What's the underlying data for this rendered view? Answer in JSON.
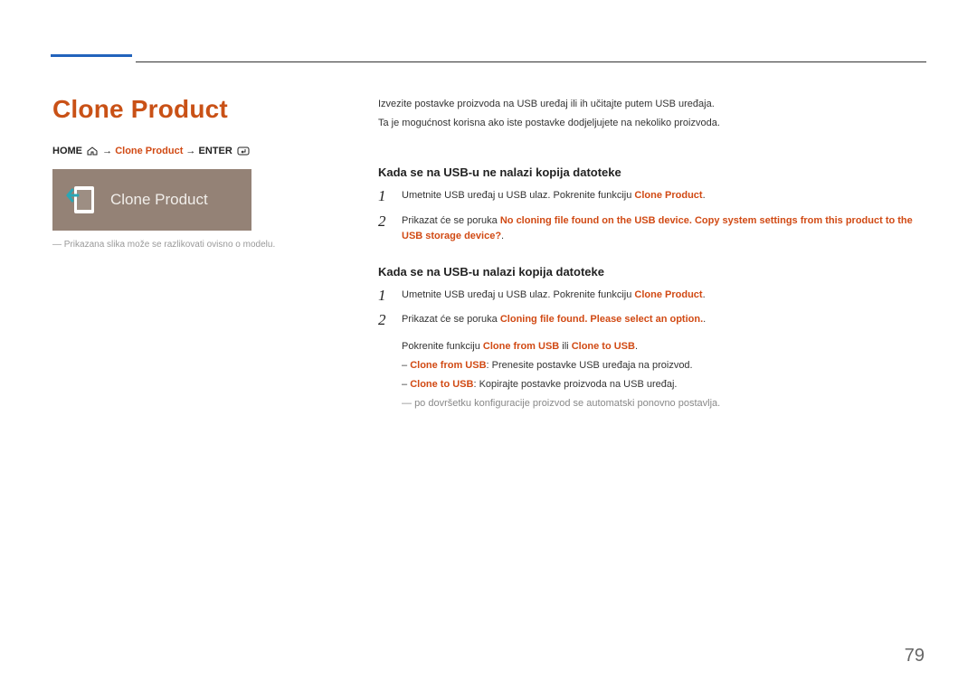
{
  "header": {
    "title": "Clone Product"
  },
  "breadcrumb": {
    "home_label": "HOME",
    "arrow": "→",
    "middle": "Clone Product",
    "enter_label": "ENTER"
  },
  "tile": {
    "label": "Clone Product"
  },
  "left_footnote": "Prikazana slika može se razlikovati ovisno o modelu.",
  "intro": {
    "line1": "Izvezite postavke proizvoda na USB uređaj ili ih učitajte putem USB uređaja.",
    "line2": "Ta je mogućnost korisna ako iste postavke dodjeljujete na nekoliko proizvoda."
  },
  "section1": {
    "heading": "Kada se na USB-u ne nalazi kopija datoteke",
    "step1": {
      "num": "1",
      "pre": "Umetnite USB uređaj u USB ulaz. Pokrenite funkciju ",
      "emph": "Clone Product",
      "post": "."
    },
    "step2": {
      "num": "2",
      "pre": "Prikazat će se poruka ",
      "emph": "No cloning file found on the USB device. Copy system settings from this product to the USB storage device?",
      "post": "."
    }
  },
  "section2": {
    "heading": "Kada se na USB-u nalazi kopija datoteke",
    "step1": {
      "num": "1",
      "pre": "Umetnite USB uređaj u USB ulaz. Pokrenite funkciju ",
      "emph": "Clone Product",
      "post": "."
    },
    "step2": {
      "num": "2",
      "pre": "Prikazat će se poruka ",
      "emph": "Cloning file found. Please select an option.",
      "post": "."
    },
    "run_pre": "Pokrenite funkciju ",
    "run_opt1": "Clone from USB",
    "run_or": " ili ",
    "run_opt2": "Clone to USB",
    "run_post": ".",
    "bullet1_emph": "Clone from USB",
    "bullet1_rest": ": Prenesite postavke USB uređaja na proizvod.",
    "bullet2_emph": "Clone to USB",
    "bullet2_rest": ": Kopirajte postavke proizvoda na USB uređaj.",
    "final_note": "po dovršetku konfiguracije proizvod se automatski ponovno postavlja."
  },
  "page_number": "79"
}
